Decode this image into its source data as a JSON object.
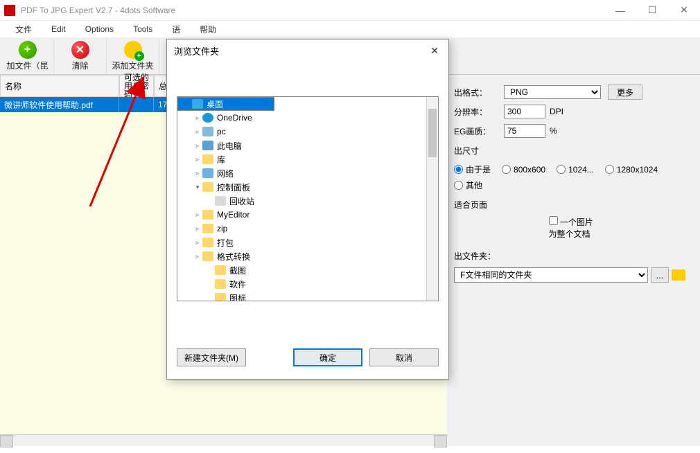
{
  "window": {
    "title": "PDF To JPG Expert V2.7 - 4dots Software"
  },
  "menu": [
    "文件",
    "Edit",
    "Options",
    "Tools",
    "语",
    "帮助"
  ],
  "toolbar": {
    "add": "加文件（昆",
    "clear": "清除",
    "addFolder": "添加文件夹"
  },
  "grid": {
    "headers": {
      "name": "名称",
      "pass": "可选的用户密码",
      "total": "总"
    },
    "row": {
      "name": "微讲师软件使用帮助.pdf",
      "pass": "",
      "total": "17"
    }
  },
  "right": {
    "outFormatLabel": "出格式：",
    "outFormatValue": "PNG",
    "more": "更多",
    "resLabel": "分辨率：",
    "resValue": "300",
    "dpi": "DPI",
    "jpegLabel": "EG画质：",
    "jpegValue": "75",
    "pct": "%",
    "outSize": "出尺寸",
    "since": "由于是",
    "r800": "800x600",
    "r1024": "1024...",
    "r1280": "1280x1024",
    "other": "其他",
    "fitPage": "适合页面",
    "oneImg": "一个图片为整个文档",
    "outFolderLabel": "出文件夹：",
    "outFolderValue": "F文件相同的文件夹",
    "ellipsis": "..."
  },
  "dialog": {
    "title": "浏览文件夹",
    "tree": [
      {
        "depth": 0,
        "label": "桌面",
        "icon": "desktop",
        "expander": "",
        "sel": true
      },
      {
        "depth": 1,
        "label": "OneDrive",
        "icon": "onedrive",
        "expander": "▹"
      },
      {
        "depth": 1,
        "label": "pc",
        "icon": "pc",
        "expander": "▹"
      },
      {
        "depth": 1,
        "label": "此电脑",
        "icon": "thispc",
        "expander": "▹"
      },
      {
        "depth": 1,
        "label": "库",
        "icon": "folder",
        "expander": "▹"
      },
      {
        "depth": 1,
        "label": "网络",
        "icon": "net",
        "expander": "▹"
      },
      {
        "depth": 1,
        "label": "控制面板",
        "icon": "folder",
        "expander": "▾"
      },
      {
        "depth": 2,
        "label": "回收站",
        "icon": "recycle",
        "expander": ""
      },
      {
        "depth": 1,
        "label": "MyEditor",
        "icon": "folder",
        "expander": "▹"
      },
      {
        "depth": 1,
        "label": "zip",
        "icon": "folder",
        "expander": "▹"
      },
      {
        "depth": 1,
        "label": "打包",
        "icon": "folder",
        "expander": "▹"
      },
      {
        "depth": 1,
        "label": "格式转换",
        "icon": "folder",
        "expander": "▹"
      },
      {
        "depth": 2,
        "label": "截图",
        "icon": "folder",
        "expander": ""
      },
      {
        "depth": 2,
        "label": "软件",
        "icon": "folder",
        "expander": ""
      },
      {
        "depth": 2,
        "label": "图标",
        "icon": "folder",
        "expander": ""
      }
    ],
    "newFolder": "新建文件夹(M)",
    "ok": "确定",
    "cancel": "取消"
  }
}
